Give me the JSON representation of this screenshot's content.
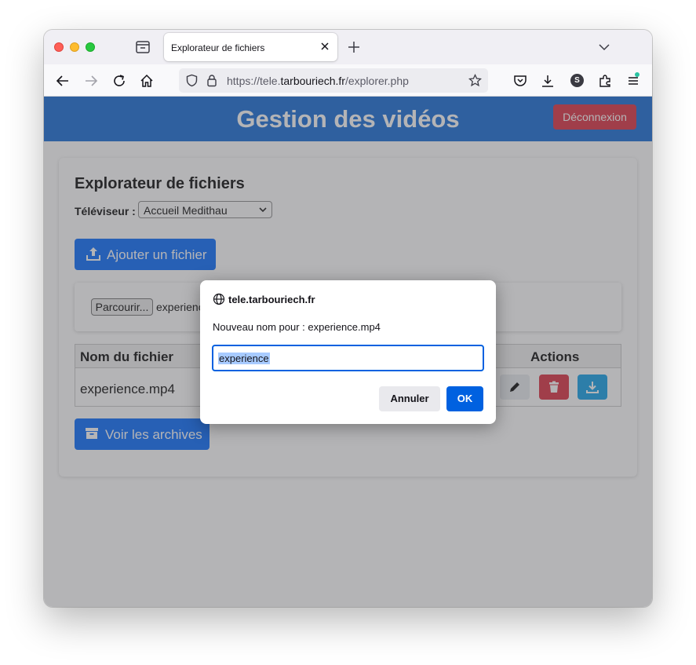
{
  "browser": {
    "tab_title": "Explorateur de fichiers",
    "url_prefix": "https://tele.",
    "url_domain": "tarbouriech.fr",
    "url_path": "/explorer.php",
    "account_initial": "S"
  },
  "header": {
    "title": "Gestion des vidéos",
    "logout_label": "Déconnexion"
  },
  "explorer": {
    "title": "Explorateur de fichiers",
    "tv_label": "Téléviseur :",
    "tv_selected": "Accueil Medithau",
    "add_file_label": "Ajouter un fichier",
    "browse_label": "Parcourir...",
    "selected_file": "experience",
    "table": {
      "columns": [
        "Nom du fichier",
        "Actions"
      ],
      "rows": [
        {
          "name": "experience.mp4"
        }
      ]
    },
    "archives_label": "Voir les archives"
  },
  "dialog": {
    "host": "tele.tarbouriech.fr",
    "message": "Nouveau nom pour : experience.mp4",
    "input_value": "experience",
    "cancel_label": "Annuler",
    "ok_label": "OK"
  },
  "colors": {
    "header_blue": "#1a6fd8",
    "button_blue": "#0d6efd",
    "danger_red": "#dc3545",
    "info_blue": "#17a2e8",
    "dialog_accent": "#0061e0"
  }
}
